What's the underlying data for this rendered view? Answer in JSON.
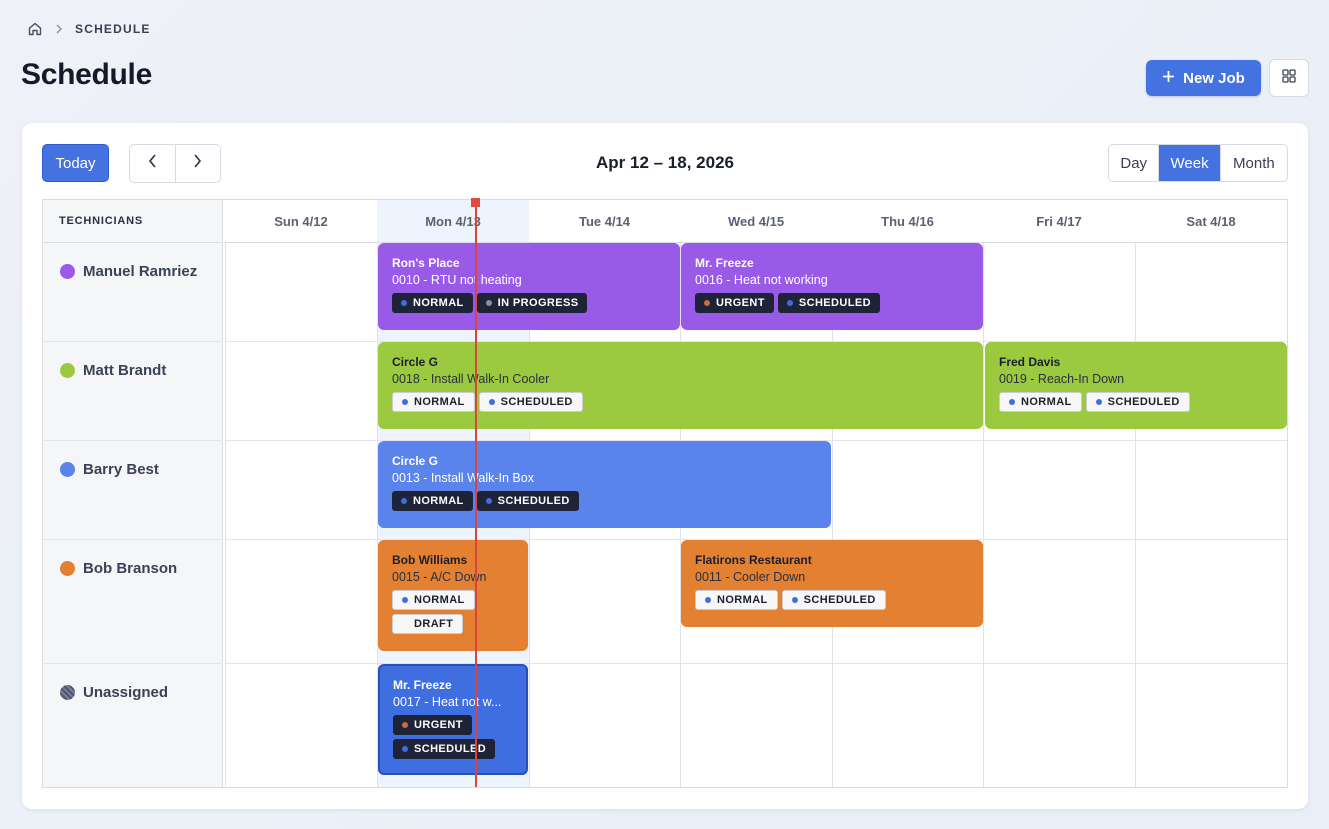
{
  "breadcrumb": {
    "current": "SCHEDULE"
  },
  "page": {
    "title": "Schedule"
  },
  "toolbar": {
    "new_job_label": "New Job"
  },
  "calendar": {
    "today_label": "Today",
    "range_title": "Apr 12 – 18, 2026",
    "views": [
      "Day",
      "Week",
      "Month"
    ],
    "active_view": "Week",
    "technicians_header": "TECHNICIANS",
    "days": [
      "Sun 4/12",
      "Mon 4/13",
      "Tue 4/14",
      "Wed 4/15",
      "Thu 4/16",
      "Fri 4/17",
      "Sat 4/18"
    ],
    "today_index": 1
  },
  "colors": {
    "accent": "#4472e0",
    "purple": "#9a5ae8",
    "green": "#9bc93f",
    "blue": "#5a84ec",
    "orange": "#e38031",
    "unassigned": "#3f6ee0",
    "now_line": "#d9453d",
    "priority_normal": "#3f6ee0",
    "priority_urgent": "#d06a3a",
    "status_in_progress": "#8a90a0"
  },
  "technicians": [
    {
      "name": "Manuel Ramriez",
      "color": "#9a5ae8"
    },
    {
      "name": "Matt Brandt",
      "color": "#9bc93f"
    },
    {
      "name": "Barry Best",
      "color": "#5a84ec"
    },
    {
      "name": "Bob Branson",
      "color": "#e38031"
    },
    {
      "name": "Unassigned",
      "color": "#5b6078"
    }
  ],
  "jobs": [
    {
      "customer": "Ron's Place",
      "number": "0010",
      "title": "RTU not heating",
      "description": "0010 - RTU not heating",
      "tags": [
        "NORMAL",
        "IN PROGRESS"
      ]
    },
    {
      "customer": "Mr. Freeze",
      "number": "0016",
      "title": "Heat not working",
      "description": "0016 - Heat not working",
      "tags": [
        "URGENT",
        "SCHEDULED"
      ]
    },
    {
      "customer": "Circle G",
      "number": "0018",
      "title": "Install Walk-In Cooler",
      "description": "0018 - Install Walk-In Cooler",
      "tags": [
        "NORMAL",
        "SCHEDULED"
      ]
    },
    {
      "customer": "Fred Davis",
      "number": "0019",
      "title": "Reach-In Down",
      "description": "0019 - Reach-In Down",
      "tags": [
        "NORMAL",
        "SCHEDULED"
      ]
    },
    {
      "customer": "Circle G",
      "number": "0013",
      "title": "Install Walk-In Box",
      "description": "0013 - Install Walk-In Box",
      "tags": [
        "NORMAL",
        "SCHEDULED"
      ]
    },
    {
      "customer": "Bob Williams",
      "number": "0015",
      "title": "A/C Down",
      "description": "0015 - A/C Down",
      "tags": [
        "NORMAL",
        "DRAFT"
      ]
    },
    {
      "customer": "Flatirons Restaurant",
      "number": "0011",
      "title": "Cooler Down",
      "description": "0011 - Cooler Down",
      "tags": [
        "NORMAL",
        "SCHEDULED"
      ]
    },
    {
      "customer": "Mr. Freeze",
      "number": "0017",
      "title": "Heat not w...",
      "description": "0017 - Heat not w...",
      "tags": [
        "URGENT",
        "SCHEDULED"
      ]
    }
  ]
}
